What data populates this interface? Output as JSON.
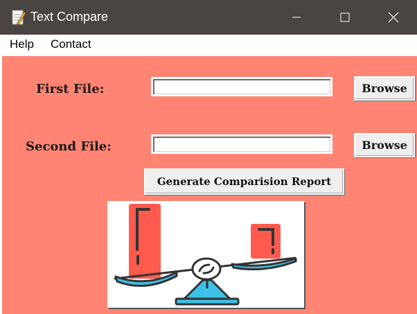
{
  "window": {
    "title": "Text Compare",
    "app_icon": "notepad-pencil-icon",
    "controls": [
      "minimize-icon",
      "maximize-icon",
      "close-icon"
    ]
  },
  "menu": {
    "items": [
      {
        "label": "Help"
      },
      {
        "label": "Contact"
      }
    ]
  },
  "form": {
    "first_file_label": "First File:",
    "first_file_value": "",
    "first_browse_label": "Browse",
    "second_file_label": "Second File:",
    "second_file_value": "",
    "second_browse_label": "Browse",
    "generate_label": "Generate Comparision Report"
  },
  "illustration": {
    "icon": "balance-scale-icon"
  },
  "colors": {
    "titlebar": "#4a4542",
    "content_background": "#ff8473",
    "scale_blue": "#3ec1e6",
    "doc_red": "#ff5a4d"
  }
}
